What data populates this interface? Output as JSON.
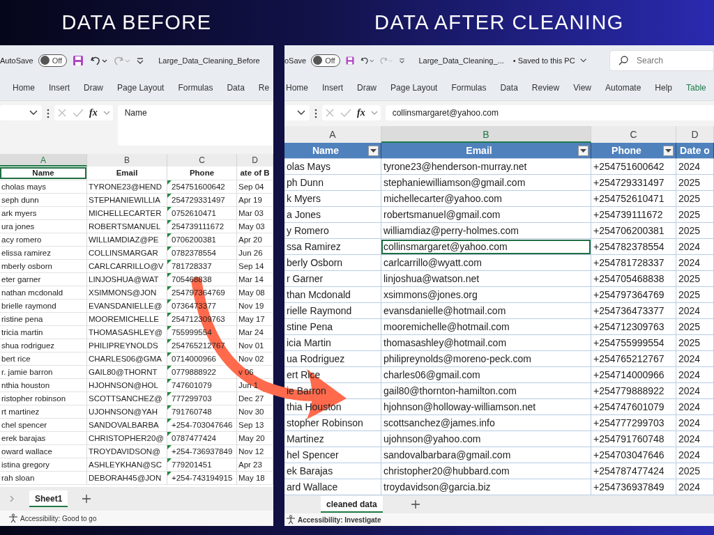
{
  "titles": [
    {
      "text": "DATA BEFORE"
    },
    {
      "text": "DATA AFTER CLEANING"
    }
  ],
  "panels": [
    {
      "kind": "plain",
      "autosave_label": "AutoSave",
      "autosave": {
        "label": "Off",
        "on": false
      },
      "file_name": "Large_Data_Cleaning_Before",
      "ribbon_tabs": [
        {
          "label": "Home",
          "kind": "normal"
        },
        {
          "label": "Insert",
          "kind": "normal"
        },
        {
          "label": "Draw",
          "kind": "normal"
        },
        {
          "label": "Page Layout",
          "kind": "normal"
        },
        {
          "label": "Formulas",
          "kind": "normal"
        },
        {
          "label": "Data",
          "kind": "normal"
        },
        {
          "label": "Re",
          "kind": "normal"
        }
      ],
      "formula_label": "fx",
      "formula": "Name",
      "formula_expanded": true,
      "columns": [
        {
          "letter": "A",
          "selected": true,
          "flagged": false
        },
        {
          "letter": "B",
          "selected": false,
          "flagged": false
        },
        {
          "letter": "C",
          "selected": false,
          "flagged": true
        },
        {
          "letter": "D",
          "selected": false,
          "flagged": false
        }
      ],
      "header": {
        "cells": [
          "Name",
          "Email",
          "Phone",
          "ate of B"
        ],
        "selected": true
      },
      "rows": [
        {
          "cells": [
            "cholas mays",
            "TYRONE23@HEND",
            "254751600642",
            "Sep 04"
          ],
          "selected": false
        },
        {
          "cells": [
            "seph dunn",
            "STEPHANIEWILLIA",
            "254729331497",
            "Apr 19"
          ],
          "selected": false
        },
        {
          "cells": [
            "ark myers",
            "MICHELLECARTER",
            "0752610471",
            "Mar 03"
          ],
          "selected": false
        },
        {
          "cells": [
            "ura jones",
            "ROBERTSMANUEL",
            "254739111672",
            "May 03"
          ],
          "selected": false
        },
        {
          "cells": [
            "acy romero",
            "WILLIAMDIAZ@PE",
            "0706200381",
            "Apr 20"
          ],
          "selected": false
        },
        {
          "cells": [
            "elissa ramirez",
            "COLLINSMARGAR",
            "0782378554",
            "Jun 26"
          ],
          "selected": false
        },
        {
          "cells": [
            "mberly osborn",
            "CARLCARRILLO@V",
            "781728337",
            "Sep 14"
          ],
          "selected": false
        },
        {
          "cells": [
            "eter garner",
            "LINJOSHUA@WAT",
            "705468838",
            "Mar 14"
          ],
          "selected": false
        },
        {
          "cells": [
            "nathan mcdonald",
            "XSIMMONS@JON",
            "254797364769",
            "May 08"
          ],
          "selected": false
        },
        {
          "cells": [
            "brielle raymond",
            "EVANSDANIELLE@",
            "0736473377",
            "Nov 19"
          ],
          "selected": false
        },
        {
          "cells": [
            "ristine pena",
            "MOOREMICHELLE",
            "254712309763",
            "May 17"
          ],
          "selected": false
        },
        {
          "cells": [
            "tricia martin",
            "THOMASASHLEY@",
            "755999554",
            "Mar 24"
          ],
          "selected": false
        },
        {
          "cells": [
            "shua rodriguez",
            "PHILIPREYNOLDS",
            "254765212767",
            "Nov 01"
          ],
          "selected": false
        },
        {
          "cells": [
            "bert rice",
            "CHARLES06@GMA",
            "0714000966",
            "Nov 02"
          ],
          "selected": false
        },
        {
          "cells": [
            "r. jamie barron",
            "GAIL80@THORNT",
            "0779888922",
            "v 06"
          ],
          "selected": false
        },
        {
          "cells": [
            "nthia houston",
            "HJOHNSON@HOL",
            "747601079",
            "Jun 1"
          ],
          "selected": false
        },
        {
          "cells": [
            "ristopher robinson",
            "SCOTTSANCHEZ@",
            "777299703",
            "Dec 27"
          ],
          "selected": false
        },
        {
          "cells": [
            "rt martinez",
            "UJOHNSON@YAH",
            "791760748",
            "Nov 30"
          ],
          "selected": false
        },
        {
          "cells": [
            "chel spencer",
            "SANDOVALBARBA",
            "+254-703047646",
            "Sep 13"
          ],
          "selected": false
        },
        {
          "cells": [
            "erek barajas",
            "CHRISTOPHER20@",
            "0787477424",
            "May 20"
          ],
          "selected": false
        },
        {
          "cells": [
            "oward wallace",
            "TROYDAVIDSON@",
            "+254-736937849",
            "Nov 12"
          ],
          "selected": false
        },
        {
          "cells": [
            "istina gregory",
            "ASHLEYKHAN@SC",
            "779201451",
            "Apr 23"
          ],
          "selected": false
        },
        {
          "cells": [
            "rah sloan",
            "DEBORAH45@JON",
            "+254-743194915",
            "May 18"
          ],
          "selected": false
        }
      ],
      "sheet_tab": {
        "label": "Sheet1",
        "selected": true
      },
      "status": "Accessibility: Good to go"
    },
    {
      "kind": "formatted",
      "autosave_label": "oSave",
      "autosave": {
        "label": "Off",
        "on": false
      },
      "file_name": "Large_Data_Cleaning_...",
      "saved_status": "• Saved to this PC",
      "search": {
        "placeholder": "Search"
      },
      "ribbon_tabs": [
        {
          "label": "Home",
          "kind": "normal"
        },
        {
          "label": "Insert",
          "kind": "normal"
        },
        {
          "label": "Draw",
          "kind": "normal"
        },
        {
          "label": "Page Layout",
          "kind": "normal"
        },
        {
          "label": "Formulas",
          "kind": "normal"
        },
        {
          "label": "Data",
          "kind": "normal"
        },
        {
          "label": "Review",
          "kind": "normal"
        },
        {
          "label": "View",
          "kind": "normal"
        },
        {
          "label": "Automate",
          "kind": "normal"
        },
        {
          "label": "Help",
          "kind": "normal"
        },
        {
          "label": "Table",
          "kind": "contextual"
        }
      ],
      "formula_label": "fx",
      "formula": "collinsmargaret@yahoo.com",
      "formula_expanded": false,
      "columns": [
        {
          "letter": "A",
          "selected": false,
          "flagged": false
        },
        {
          "letter": "B",
          "selected": true,
          "flagged": false
        },
        {
          "letter": "C",
          "selected": false,
          "flagged": false
        },
        {
          "letter": "D",
          "selected": false,
          "flagged": false
        }
      ],
      "header": {
        "cells": [
          "Name",
          "Email",
          "Phone",
          "Date o"
        ],
        "selected": false
      },
      "rows": [
        {
          "cells": [
            "olas Mays",
            "tyrone23@henderson-murray.net",
            "+254751600642",
            "2024"
          ],
          "selected": false
        },
        {
          "cells": [
            "ph Dunn",
            "stephaniewilliamson@gmail.com",
            "+254729331497",
            "2025"
          ],
          "selected": false
        },
        {
          "cells": [
            "k Myers",
            "michellecarter@yahoo.com",
            "+254752610471",
            "2025"
          ],
          "selected": false
        },
        {
          "cells": [
            "a Jones",
            "robertsmanuel@gmail.com",
            "+254739111672",
            "2025"
          ],
          "selected": false
        },
        {
          "cells": [
            "y Romero",
            "williamdiaz@perry-holmes.com",
            "+254706200381",
            "2025"
          ],
          "selected": false
        },
        {
          "cells": [
            "ssa Ramirez",
            "collinsmargaret@yahoo.com",
            "+254782378554",
            "2024"
          ],
          "selected": true
        },
        {
          "cells": [
            "berly Osborn",
            "carlcarrillo@wyatt.com",
            "+254781728337",
            "2024"
          ],
          "selected": false
        },
        {
          "cells": [
            "r Garner",
            "linjoshua@watson.net",
            "+254705468838",
            "2025"
          ],
          "selected": false
        },
        {
          "cells": [
            "than Mcdonald",
            "xsimmons@jones.org",
            "+254797364769",
            "2025"
          ],
          "selected": false
        },
        {
          "cells": [
            "rielle Raymond",
            "evansdanielle@hotmail.com",
            "+254736473377",
            "2024"
          ],
          "selected": false
        },
        {
          "cells": [
            "stine Pena",
            "mooremichelle@hotmail.com",
            "+254712309763",
            "2025"
          ],
          "selected": false
        },
        {
          "cells": [
            "icia Martin",
            "thomasashley@hotmail.com",
            "+254755999554",
            "2025"
          ],
          "selected": false
        },
        {
          "cells": [
            "ua Rodriguez",
            "philipreynolds@moreno-peck.com",
            "+254765212767",
            "2024"
          ],
          "selected": false
        },
        {
          "cells": [
            "ert Rice",
            "charles06@gmail.com",
            "+254714000966",
            "2024"
          ],
          "selected": false
        },
        {
          "cells": [
            "ie Barron",
            "gail80@thornton-hamilton.com",
            "+254779888922",
            "2024"
          ],
          "selected": false
        },
        {
          "cells": [
            "thia Houston",
            "hjohnson@holloway-williamson.net",
            "+254747601079",
            "2024"
          ],
          "selected": false
        },
        {
          "cells": [
            "stopher Robinson",
            "scottsanchez@james.info",
            "+254777299703",
            "2024"
          ],
          "selected": false
        },
        {
          "cells": [
            "Martinez",
            "ujohnson@yahoo.com",
            "+254791760748",
            "2024"
          ],
          "selected": false
        },
        {
          "cells": [
            "hel Spencer",
            "sandovalbarbara@gmail.com",
            "+254703047646",
            "2024"
          ],
          "selected": false
        },
        {
          "cells": [
            "ek Barajas",
            "christopher20@hubbard.com",
            "+254787477424",
            "2025"
          ],
          "selected": false
        },
        {
          "cells": [
            "ard Wallace",
            "troydavidson@garcia.biz",
            "+254736937849",
            "2024"
          ],
          "selected": false
        }
      ],
      "sheet_tab": {
        "label": "cleaned data",
        "selected": true
      },
      "status": "Accessibility: Investigate"
    }
  ]
}
